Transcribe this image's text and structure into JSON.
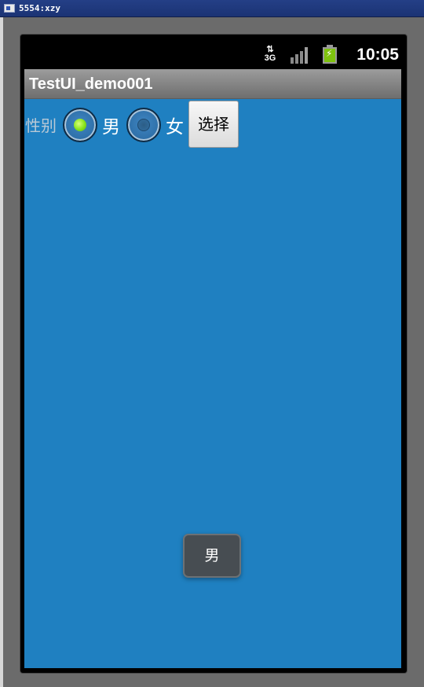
{
  "window": {
    "title": "5554:xzy"
  },
  "status_bar": {
    "network": "3G",
    "time": "10:05",
    "battery": "charging"
  },
  "app": {
    "title": "TestUI_demo001"
  },
  "form": {
    "label": "性别",
    "options": [
      {
        "label": "男",
        "checked": true
      },
      {
        "label": "女",
        "checked": false
      }
    ],
    "button_label": "选择"
  },
  "toast": {
    "text": "男"
  },
  "colors": {
    "content_bg": "#1f80c1",
    "title_bar": "#8a8a8a",
    "radio_checked": "#87e31a",
    "battery": "#7ec20e"
  }
}
